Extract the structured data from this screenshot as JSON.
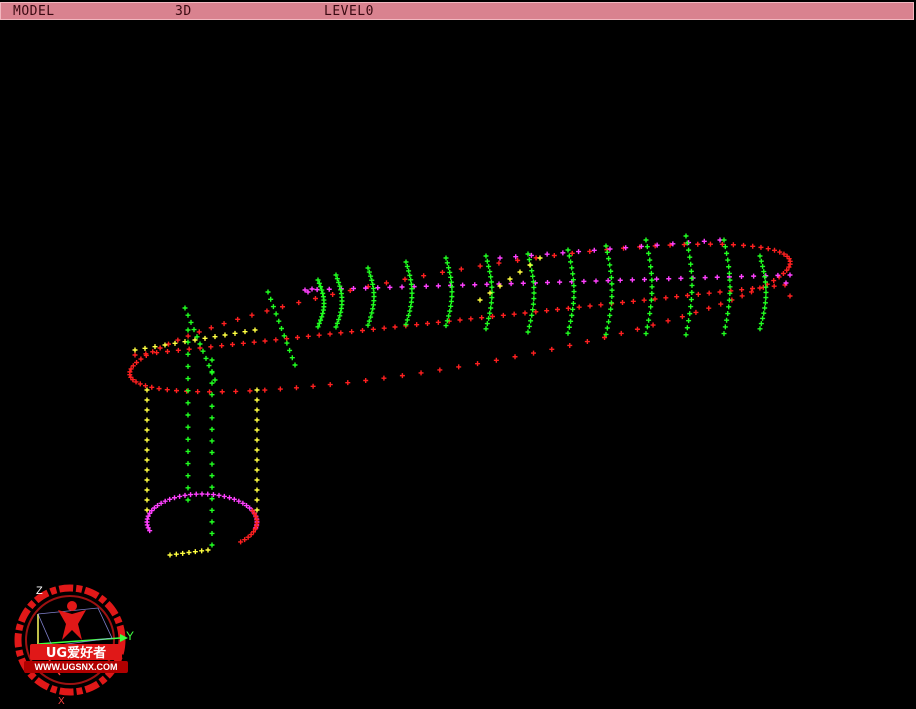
{
  "statusbar": {
    "view_mode": "MODEL",
    "dimension": "3D",
    "level": "LEVEL0"
  },
  "scene": {
    "background": "#000000",
    "marker_glyph": "+",
    "colors": {
      "red": "#ff2020",
      "green": "#20ff20",
      "yellow": "#ffff40",
      "magenta": "#ff40ff"
    }
  },
  "triad": {
    "axis_y_label": "Y",
    "axis_z_label": "Z",
    "axis_x_label": "X"
  },
  "watermark": {
    "brand": "UG爱好者",
    "url": "WWW.UGSNX.COM"
  }
}
